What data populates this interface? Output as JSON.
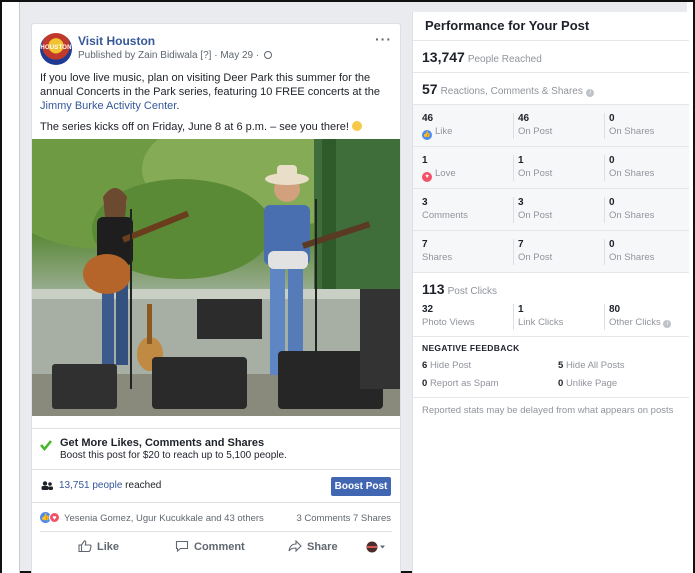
{
  "post": {
    "page_name": "Visit Houston",
    "avatar_text": "HOUSTON",
    "published": "Published by Zain Bidiwala",
    "published_tag": "[?]",
    "date": "May 29",
    "more": "···",
    "text_p1_before": "If you love live music, plan on visiting Deer Park this summer for the annual Concerts in the Park series, featuring 10 FREE concerts at the ",
    "text_p1_link": "Jimmy Burke Activity Center",
    "text_p1_after": ".",
    "text_p2": "The series kicks off on Friday, June 8 at 6 p.m. – see you there!",
    "boost_title": "Get More Likes, Comments and Shares",
    "boost_sub": "Boost this post for $20 to reach up to 5,100 people.",
    "reach_link": "13,751 people",
    "reach_suffix": " reached",
    "boost_button": "Boost Post",
    "reactors": "Yesenia Gomez, Ugur Kucukkale and 43 others",
    "comments_shares": "3 Comments  7 Shares",
    "action_like": "Like",
    "action_comment": "Comment",
    "action_share": "Share"
  },
  "panel": {
    "title": "Performance for Your Post",
    "people_reached_value": "13,747",
    "people_reached_label": "People Reached",
    "reactions_value": "57",
    "reactions_label": "Reactions, Comments & Shares",
    "rows": [
      {
        "v1": "46",
        "l1": "Like",
        "v2": "46",
        "l2": "On Post",
        "v3": "0",
        "l3": "On Shares"
      },
      {
        "v1": "1",
        "l1": "Love",
        "v2": "1",
        "l2": "On Post",
        "v3": "0",
        "l3": "On Shares"
      },
      {
        "v1": "3",
        "l1": "Comments",
        "v2": "3",
        "l2": "On Post",
        "v3": "0",
        "l3": "On Shares"
      },
      {
        "v1": "7",
        "l1": "Shares",
        "v2": "7",
        "l2": "On Post",
        "v3": "0",
        "l3": "On Shares"
      }
    ],
    "post_clicks_value": "113",
    "post_clicks_label": "Post Clicks",
    "clicks": {
      "v1": "32",
      "l1": "Photo Views",
      "v2": "1",
      "l2": "Link Clicks",
      "v3": "80",
      "l3": "Other Clicks"
    },
    "negative_title": "NEGATIVE FEEDBACK",
    "neg": {
      "hide_post_value": "6",
      "hide_post_label": "Hide Post",
      "hide_all_value": "5",
      "hide_all_label": "Hide All Posts",
      "spam_value": "0",
      "spam_label": "Report as Spam",
      "unlike_value": "0",
      "unlike_label": "Unlike Page"
    },
    "reported_note": "Reported stats may be delayed from what appears on posts"
  },
  "colors": {
    "link": "#365899",
    "boost": "#4267b2",
    "like": "#4e8cf1",
    "love": "#f25268"
  }
}
